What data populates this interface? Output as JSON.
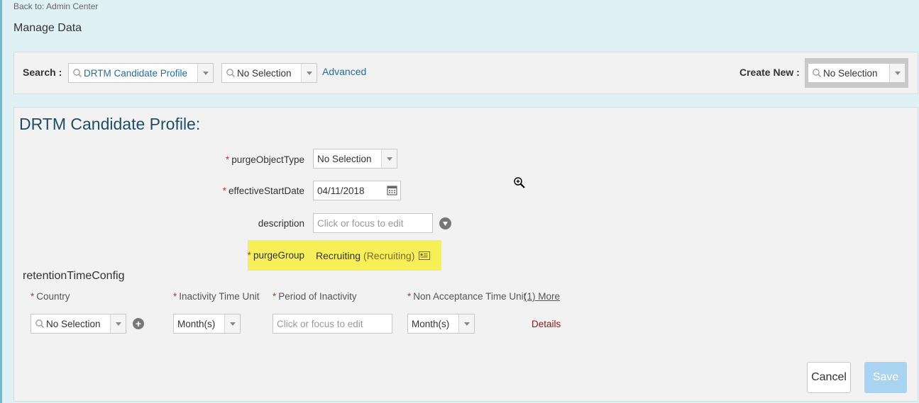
{
  "header": {
    "back_link": "Back to: Admin Center",
    "page_title": "Manage Data"
  },
  "search": {
    "label": "Search :",
    "object_value": "DRTM Candidate Profile",
    "instance_value": "No Selection",
    "advanced_label": "Advanced",
    "create_label": "Create New :",
    "create_value": "No Selection"
  },
  "form": {
    "title": "DRTM Candidate Profile:",
    "purge_object_type": {
      "label": "purgeObjectType",
      "value": "No Selection"
    },
    "effective_start_date": {
      "label": "effectiveStartDate",
      "value": "04/11/2018"
    },
    "description": {
      "label": "description",
      "placeholder": "Click or focus to edit"
    },
    "purge_group": {
      "label": "purgeGroup",
      "value": "Recruiting",
      "sub_value": "(Recruiting)"
    }
  },
  "retention": {
    "title": "retentionTimeConfig",
    "columns": [
      "Country",
      "Inactivity Time Unit",
      "Period of Inactivity",
      "Non Acceptance Time Unit"
    ],
    "more_link": "(1) More",
    "row": {
      "country": "No Selection",
      "inactivity_unit": "Month(s)",
      "period_placeholder": "Click or focus to edit",
      "non_acceptance_unit": "Month(s)",
      "details_link": "Details"
    }
  },
  "actions": {
    "cancel_label": "Cancel",
    "save_label": "Save"
  },
  "colors": {
    "page_bg": "#dff1f5",
    "panel_bg": "#f2f2f2",
    "title_blue": "#1d4d6a",
    "link_blue": "#1f6f9f",
    "highlight_yellow": "#f7ef58",
    "required_red": "#c0392b",
    "save_disabled": "#a8d4f2"
  },
  "icons": [
    "search-icon",
    "chevron-down-icon",
    "calendar-icon",
    "help-icon",
    "card-icon",
    "add-icon",
    "zoom-cursor-icon"
  ]
}
